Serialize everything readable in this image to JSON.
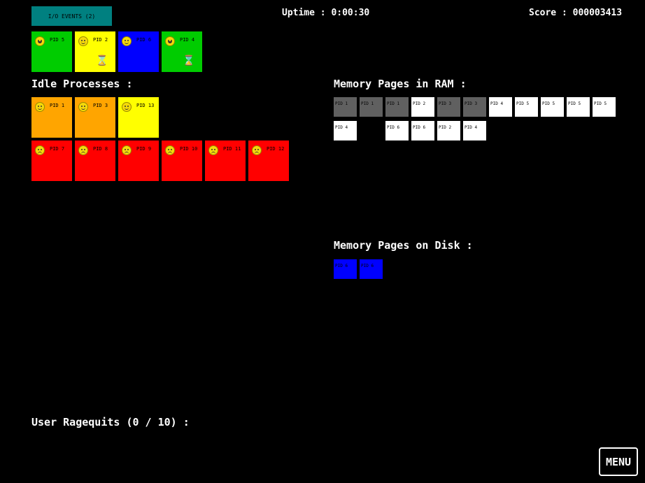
{
  "header": {
    "io_events_label": "I/O EVENTS (2)",
    "uptime": "Uptime : 0:00:30",
    "score": "Score : 000003413"
  },
  "cpu_processes": [
    {
      "pid": "PID 5",
      "color": "#00cc00",
      "mood": "happy",
      "waiting": false
    },
    {
      "pid": "PID 2",
      "color": "#ffff00",
      "mood": "neutral",
      "waiting": true
    },
    {
      "pid": "PID 6",
      "color": "#0000ff",
      "mood": "neutral",
      "waiting": false
    },
    {
      "pid": "PID 4",
      "color": "#00cc00",
      "mood": "happy",
      "waiting": true
    }
  ],
  "idle_title": "Idle Processes :",
  "idle_processes_row1": [
    {
      "pid": "PID 1",
      "color": "#ffa500",
      "mood": "neutral"
    },
    {
      "pid": "PID 3",
      "color": "#ffa500",
      "mood": "neutral"
    },
    {
      "pid": "PID 13",
      "color": "#ffff00",
      "mood": "neutral"
    }
  ],
  "idle_processes_row2": [
    {
      "pid": "PID 7",
      "color": "#ff0000",
      "mood": "sad"
    },
    {
      "pid": "PID 8",
      "color": "#ff0000",
      "mood": "sad"
    },
    {
      "pid": "PID 9",
      "color": "#ff0000",
      "mood": "sad"
    },
    {
      "pid": "PID 10",
      "color": "#ff0000",
      "mood": "sad"
    },
    {
      "pid": "PID 11",
      "color": "#ff0000",
      "mood": "sad"
    },
    {
      "pid": "PID 12",
      "color": "#ff0000",
      "mood": "sad"
    }
  ],
  "ram_title": "Memory Pages in RAM :",
  "ram_pages_row1": [
    {
      "label": "PID 1",
      "color": "#606060"
    },
    {
      "label": "PID 1",
      "color": "#606060"
    },
    {
      "label": "PID 1",
      "color": "#606060"
    },
    {
      "label": "PID 2",
      "color": "#ffffff"
    },
    {
      "label": "PID 3",
      "color": "#606060"
    },
    {
      "label": "PID 3",
      "color": "#606060"
    },
    {
      "label": "PID 4",
      "color": "#ffffff"
    },
    {
      "label": "PID 5",
      "color": "#ffffff"
    },
    {
      "label": "PID 5",
      "color": "#ffffff"
    },
    {
      "label": "PID 5",
      "color": "#ffffff"
    },
    {
      "label": "PID 5",
      "color": "#ffffff"
    }
  ],
  "ram_pages_row2": [
    {
      "label": "PID 4",
      "color": "#ffffff",
      "slot": 0
    },
    {
      "label": "PID 6",
      "color": "#ffffff",
      "slot": 2
    },
    {
      "label": "PID 6",
      "color": "#ffffff",
      "slot": 3
    },
    {
      "label": "PID 2",
      "color": "#ffffff",
      "slot": 4
    },
    {
      "label": "PID 4",
      "color": "#ffffff",
      "slot": 5
    }
  ],
  "disk_title": "Memory Pages on Disk :",
  "disk_pages": [
    {
      "label": "PID 6",
      "color": "#0000ff"
    },
    {
      "label": "PID 6",
      "color": "#0000ff"
    }
  ],
  "ragequits": "User Ragequits (0 / 10) :",
  "menu_label": "MENU"
}
